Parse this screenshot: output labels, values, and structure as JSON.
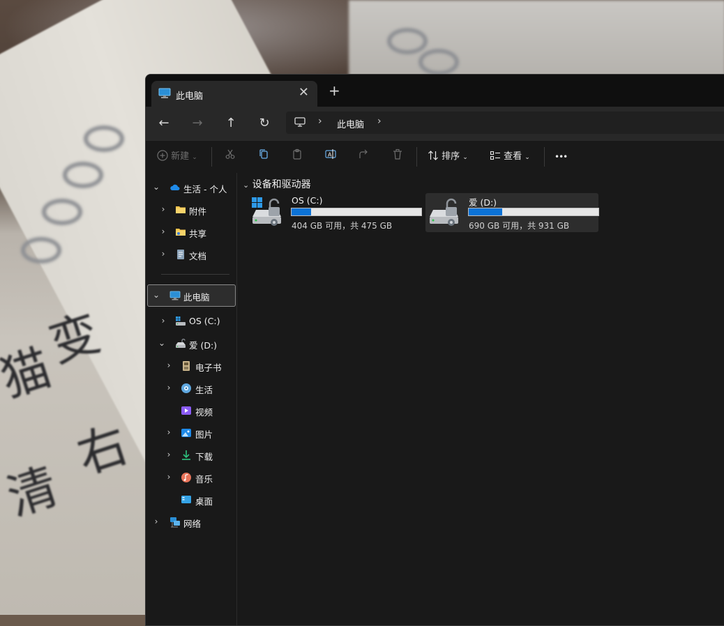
{
  "window": {
    "tab_title": "此电脑",
    "tab_close": "✕",
    "new_tab": "+"
  },
  "nav": {
    "back": "←",
    "forward": "→",
    "up": "↑",
    "refresh": "↻",
    "breadcrumb": [
      "此电脑"
    ],
    "separator": "›"
  },
  "toolbar": {
    "new_label": "新建",
    "sort_label": "排序",
    "view_label": "查看",
    "more_label": "•••"
  },
  "sidebar": {
    "items": [
      {
        "label": "生活 - 个人",
        "icon": "onedrive-cloud-icon",
        "expanded": true
      },
      {
        "label": "附件",
        "icon": "folder-icon"
      },
      {
        "label": "共享",
        "icon": "shared-folder-icon"
      },
      {
        "label": "文档",
        "icon": "document-icon"
      },
      {
        "label": "此电脑",
        "icon": "this-pc-icon",
        "expanded": true,
        "selected": true
      },
      {
        "label": "OS (C:)",
        "icon": "windows-drive-icon"
      },
      {
        "label": "爱 (D:)",
        "icon": "drive-icon",
        "expanded": true
      },
      {
        "label": "电子书",
        "icon": "ebook-folder-icon"
      },
      {
        "label": "生活",
        "icon": "life-folder-icon"
      },
      {
        "label": "视频",
        "icon": "videos-icon"
      },
      {
        "label": "图片",
        "icon": "pictures-icon"
      },
      {
        "label": "下载",
        "icon": "downloads-icon"
      },
      {
        "label": "音乐",
        "icon": "music-icon"
      },
      {
        "label": "桌面",
        "icon": "desktop-icon"
      },
      {
        "label": "网络",
        "icon": "network-icon"
      }
    ]
  },
  "content": {
    "group_title": "设备和驱动器",
    "drives": [
      {
        "name": "OS (C:)",
        "free_text": "404 GB 可用，共 475 GB",
        "used_fraction": 0.15,
        "icon": "windows-drive-icon"
      },
      {
        "name": "爱 (D:)",
        "free_text": "690 GB 可用，共 931 GB",
        "used_fraction": 0.26,
        "icon": "drive-icon",
        "selected": true
      }
    ]
  },
  "colors": {
    "accent": "#0b72d6",
    "window_bg": "#191919",
    "titlebar_bg": "#0f0f0f",
    "navbar_bg": "#282828"
  }
}
